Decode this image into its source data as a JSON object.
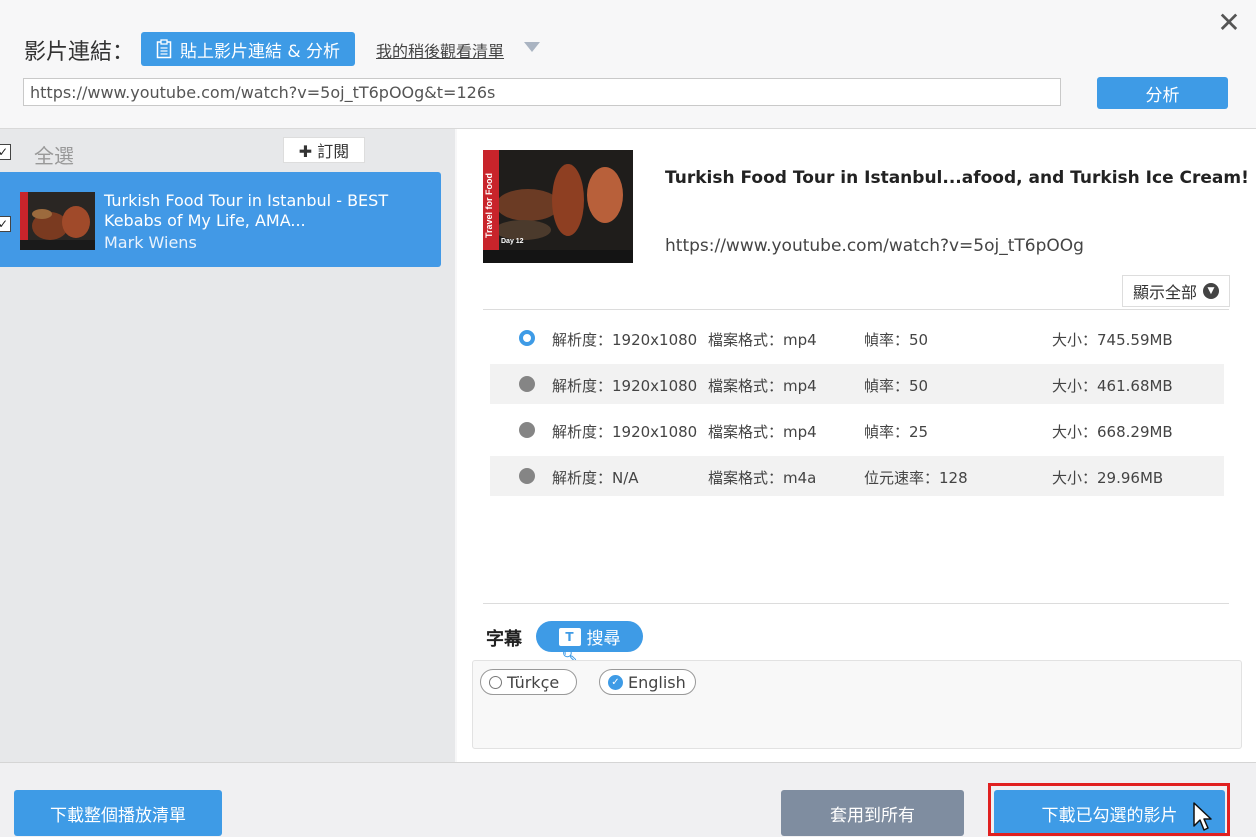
{
  "header": {
    "link_label": "影片連結：",
    "paste_button": "貼上影片連結 & 分析",
    "watchlist_link": "我的稍後觀看清單",
    "url_value": "https://www.youtube.com/watch?v=5oj_tT6pOOg&t=126s",
    "analyze_button": "分析",
    "close_glyph": "✕"
  },
  "left": {
    "select_all": "全選",
    "subscribe_button": "✚ 訂閱",
    "items": [
      {
        "title": "Turkish Food Tour in Istanbul - BEST Kebabs of My Life, AMA...",
        "author": "Mark Wiens",
        "checked": true
      }
    ]
  },
  "detail": {
    "title": "Turkish Food Tour in Istanbul...afood, and Turkish Ice Cream!",
    "url": "https://www.youtube.com/watch?v=5oj_tT6pOOg",
    "thumb_side_text": "Travel for Food",
    "thumb_day_text": "Day 12",
    "show_all": "顯示全部",
    "formats": [
      {
        "resolution": "解析度：1920x1080",
        "format": "檔案格式：mp4",
        "rate": "幀率：50",
        "size": "大小：745.59MB",
        "selected": true
      },
      {
        "resolution": "解析度：1920x1080",
        "format": "檔案格式：mp4",
        "rate": "幀率：50",
        "size": "大小：461.68MB",
        "selected": false
      },
      {
        "resolution": "解析度：1920x1080",
        "format": "檔案格式：mp4",
        "rate": "幀率：25",
        "size": "大小：668.29MB",
        "selected": false
      },
      {
        "resolution": "解析度：N/A",
        "format": "檔案格式：m4a",
        "rate": "位元速率：128",
        "size": "大小：29.96MB",
        "selected": false
      }
    ]
  },
  "subtitles": {
    "label": "字幕",
    "search_button": "搜尋",
    "languages": [
      {
        "name": "Türkçe",
        "checked": false
      },
      {
        "name": "English",
        "checked": true
      }
    ]
  },
  "footer": {
    "download_playlist": "下載整個播放清單",
    "apply_all": "套用到所有",
    "download_selected": "下載已勾選的影片"
  },
  "colors": {
    "accent": "#3e9be6",
    "selected_row": "#4299e6",
    "secondary_button": "#7f8da0",
    "highlight_border": "#e02020"
  }
}
